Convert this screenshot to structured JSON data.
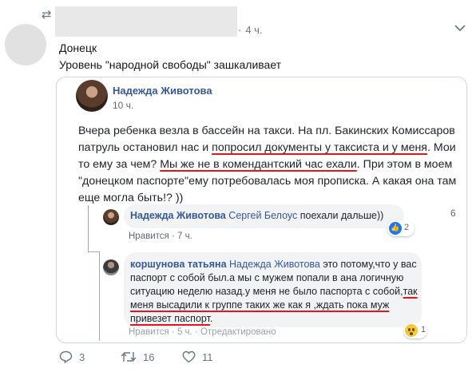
{
  "tweet": {
    "time": "4 ч.",
    "separator": "·",
    "text_line1": "Донецк",
    "text_line2": "Уровень \"народной свободы\" зашкаливает"
  },
  "fb_post": {
    "author": "Надежда Животова",
    "time": "10 ч.",
    "text_part1": "Вчера ребенка везла в бассейн на такси. На пл. Бакинских Комиссаров патруль остановил нас и ",
    "text_ul1": "попросил документы у таксиста и у меня",
    "text_part2": ". Мои то ему за чем? ",
    "text_ul2": "Мы же не в комендантский час ехали",
    "text_part3": ". При этом в моем \"донецком паспорте\"ему потребовалась моя прописка. А какая она там еще могла быть!? ))"
  },
  "comment1": {
    "author": "Надежда Животова",
    "mention": "Сергей Белоус",
    "text": " поехали дальше))",
    "like_label": "Нравится",
    "time": "7 ч.",
    "reaction_count": "2",
    "side_number": "6"
  },
  "comment2": {
    "author": "коршунова татьяна",
    "mention": "Надежда Животова",
    "text_part1": " это потому,что у вас паспорт с собой был.а мы с мужем попали в ана логичную ситуацию неделю назад.у меня не было паспорта с собой,",
    "text_ul": "так меня высадили к группе таких же как я ,ждать пока муж привезет паспорт",
    "text_part2": ".",
    "meta_partial": "Нравится · 5 ч. · Отредактировано",
    "reaction_count": "1"
  },
  "actions": {
    "replies": "3",
    "retweets": "16",
    "likes": "11"
  },
  "colors": {
    "fb_link": "#365899",
    "underline_red": "#e2161c",
    "twitter_gray": "#657786"
  }
}
